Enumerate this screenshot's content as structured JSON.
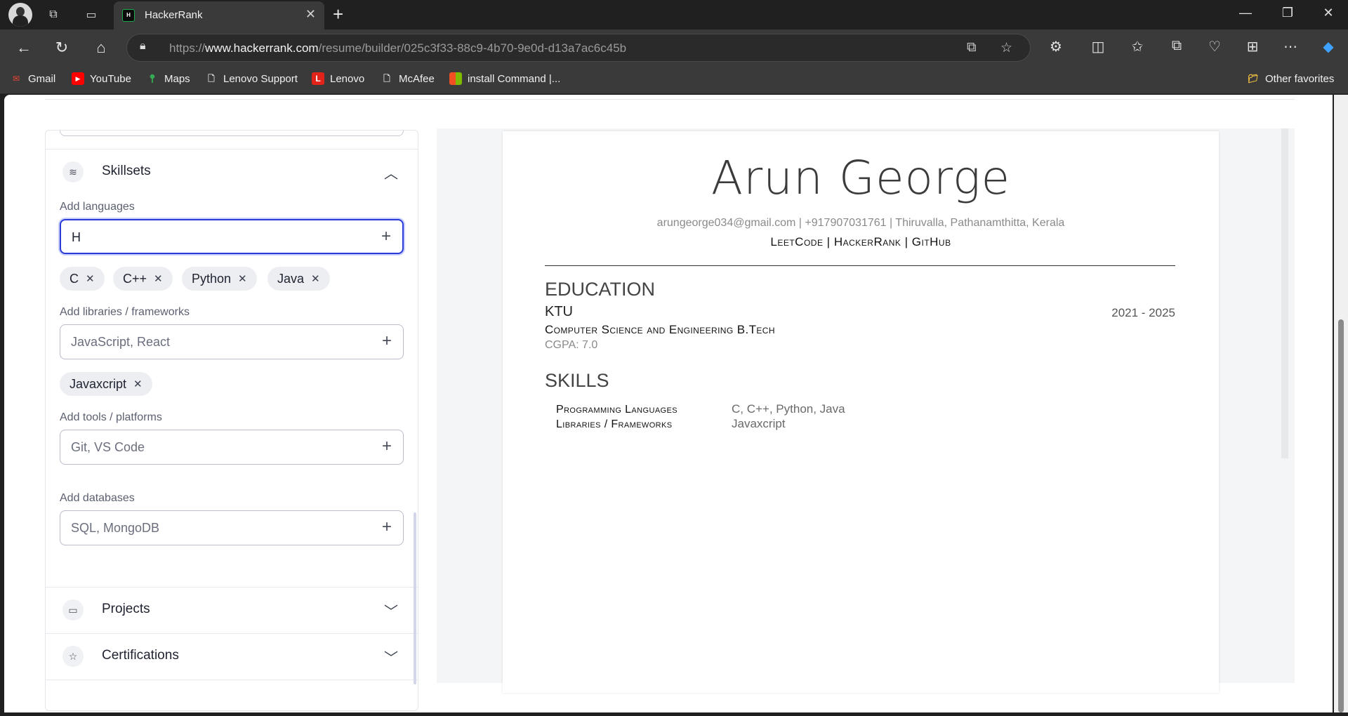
{
  "browser": {
    "tab_title": "HackerRank",
    "url_prefix": "https://",
    "url_domain": "www.hackerrank.com",
    "url_path": "/resume/builder/025c3f33-88c9-4b70-9e0d-d13a7ac6c45b",
    "bookmarks": [
      {
        "label": "Gmail",
        "icon": "gmail-icon",
        "color": "#ea4335"
      },
      {
        "label": "YouTube",
        "icon": "youtube-icon",
        "color": "#ff0000"
      },
      {
        "label": "Maps",
        "icon": "maps-icon",
        "color": "#34a853"
      },
      {
        "label": "Lenovo Support",
        "icon": "page-icon",
        "color": "#cccccc"
      },
      {
        "label": "Lenovo",
        "icon": "lenovo-icon",
        "color": "#e2231a"
      },
      {
        "label": "McAfee",
        "icon": "page-icon",
        "color": "#cccccc"
      },
      {
        "label": "install Command |...",
        "icon": "microsoft-icon",
        "color": "#f25022"
      }
    ],
    "other_favorites": "Other favorites"
  },
  "editor": {
    "skillsets": {
      "title": "Skillsets",
      "languages": {
        "label": "Add languages",
        "value": "H",
        "chips": [
          "C",
          "C++",
          "Python",
          "Java"
        ]
      },
      "libraries": {
        "label": "Add libraries / frameworks",
        "placeholder": "JavaScript, React",
        "chips": [
          "Javaxcript"
        ]
      },
      "tools": {
        "label": "Add tools / platforms",
        "placeholder": "Git, VS Code"
      },
      "databases": {
        "label": "Add databases",
        "placeholder": "SQL, MongoDB"
      }
    },
    "projects": {
      "title": "Projects"
    },
    "certifications": {
      "title": "Certifications"
    }
  },
  "resume": {
    "name": "Arun George",
    "contact": "arungeorge034@gmail.com | +917907031761 | Thiruvalla, Pathanamthitta, Kerala",
    "links": "LeetCode | HackerRank | GitHub",
    "education_heading": "EDUCATION",
    "school": "KTU",
    "years": "2021 - 2025",
    "degree": "Computer Science and Engineering B.Tech",
    "cgpa": "CGPA: 7.0",
    "skills_heading": "SKILLS",
    "skills": [
      {
        "key": "Programming Languages",
        "value": "C, C++, Python, Java"
      },
      {
        "key": "Libraries / Frameworks",
        "value": "Javaxcript"
      }
    ]
  },
  "colors": {
    "accent_focus": "#2a3bd6",
    "hackerrank_green": "#1ba94c"
  }
}
